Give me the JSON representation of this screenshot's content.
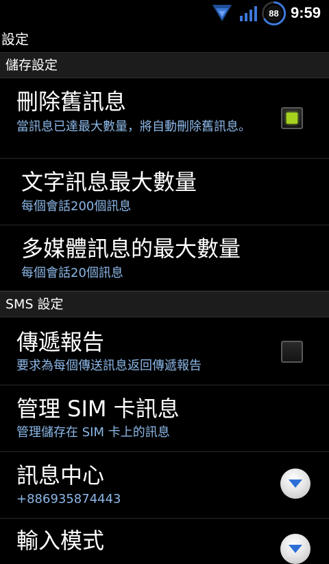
{
  "status_bar": {
    "battery_level": "88",
    "time": "9:59",
    "icons": [
      "wifi-icon",
      "signal-icon",
      "battery-icon"
    ]
  },
  "title": "設定",
  "sections": {
    "storage": {
      "header": "儲存設定",
      "delete_old": {
        "title": "刪除舊訊息",
        "summary": "當訊息已達最大數量，將自動刪除舊訊息。",
        "checked": true
      },
      "text_limit": {
        "title": "文字訊息最大數量",
        "summary": "每個會話200個訊息"
      },
      "mms_limit": {
        "title": "多媒體訊息的最大數量",
        "summary": "每個會話20個訊息"
      }
    },
    "sms": {
      "header": "SMS 設定",
      "delivery_reports": {
        "title": "傳遞報告",
        "summary": "要求為每個傳送訊息返回傳遞報告",
        "checked": false
      },
      "manage_sim": {
        "title": "管理 SIM 卡訊息",
        "summary": "管理儲存在 SIM 卡上的訊息"
      },
      "message_center": {
        "title": "訊息中心",
        "summary": "+886935874443"
      },
      "input_mode": {
        "title": "輸入模式"
      }
    }
  },
  "colors": {
    "background": "#000000",
    "summary_text": "#8cb8e8",
    "checkbox_checked": "#a6d21e",
    "section_header_bg": "#1c1c1c",
    "status_icon_blue": "#3c78d8"
  }
}
